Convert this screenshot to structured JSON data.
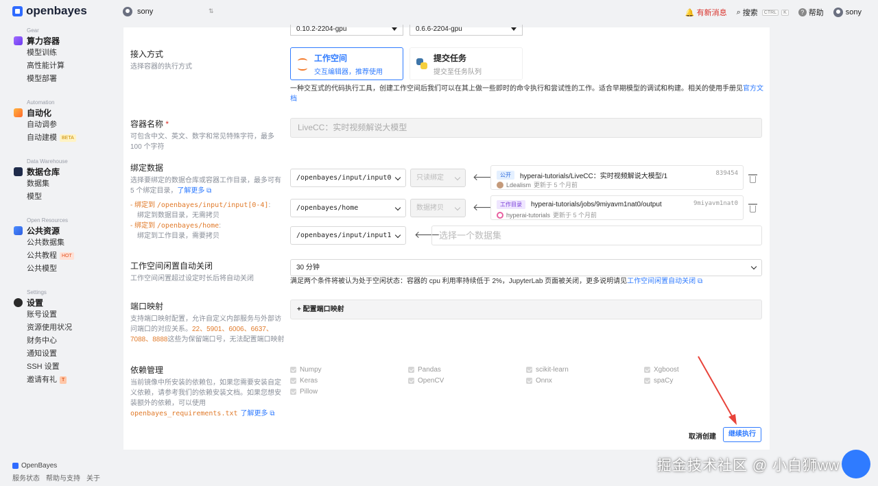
{
  "topbar": {
    "logo": "openbayes",
    "user": "sony",
    "notifications": "有新消息",
    "search": "搜索",
    "search_kbd1": "CTRL",
    "search_kbd2": "K",
    "help": "帮助",
    "account": "sony"
  },
  "sidebar": {
    "sections": [
      {
        "category": "Gear",
        "title": "算力容器",
        "items": [
          "模型训练",
          "高性能计算",
          "模型部署"
        ]
      },
      {
        "category": "Automation",
        "title": "自动化",
        "items": [
          "自动调参",
          "自动建模"
        ],
        "badge": "BETA"
      },
      {
        "category": "Data Warehouse",
        "title": "数据仓库",
        "items": [
          "数据集",
          "模型"
        ]
      },
      {
        "category": "Open Resources",
        "title": "公共资源",
        "items": [
          "公共数据集",
          "公共教程",
          "公共模型"
        ],
        "badge": "HOT"
      },
      {
        "category": "Settings",
        "title": "设置",
        "items": [
          "账号设置",
          "资源使用状况",
          "财务中心",
          "通知设置",
          "SSH 设置",
          "邀请有礼"
        ],
        "badge": "T"
      }
    ],
    "footer": {
      "brand": "OpenBayes",
      "links": [
        "服务状态",
        "帮助与支持",
        "关于"
      ]
    }
  },
  "form": {
    "version_a": "0.10.2-2204-gpu",
    "version_b": "0.6.6-2204-gpu",
    "access": {
      "label": "接入方式",
      "desc": "选择容器的执行方式",
      "workspace_title": "工作空间",
      "workspace_sub": "交互编辑器，推荐使用",
      "task_title": "提交任务",
      "task_sub": "提交至任务队列",
      "info": "一种交互式的代码执行工具，创建工作空间后我们可以在其上做一些即时的命令执行和尝试性的工作。适合早期模型的调试和构建。相关的使用手册见",
      "info_link": "官方文档"
    },
    "name": {
      "label": "容器名称",
      "required": "*",
      "desc": "可包含中文、英文、数字和常见特殊字符，最多 100 个字符",
      "value": "LiveCC：实时视频解说大模型"
    },
    "bind": {
      "label": "绑定数据",
      "desc": "选择要绑定的数据仓库或容器工作目录，最多可有 5 个绑定目录，",
      "learn_more": "了解更多",
      "rule1_prefix": "- 绑定到",
      "rule1_path": "/openbayes/input/input[0-4]",
      "rule1_suffix": ":",
      "rule1_desc": "绑定到数据目录，无需拷贝",
      "rule2_prefix": "- 绑定到",
      "rule2_path": "/openbayes/home",
      "rule2_suffix": ":",
      "rule2_desc": "绑定到工作目录，需要拷贝",
      "rows": [
        {
          "path": "/openbayes/input/input0",
          "mode": "只读绑定",
          "tag": "公开",
          "name": "hyperai-tutorials/LiveCC：实时视频解说大模型/1",
          "hash": "839454",
          "user": "Ldealism",
          "updated": "更新于 5 个月前"
        },
        {
          "path": "/openbayes/home",
          "mode": "数据拷贝",
          "tag": "工作目录",
          "name": "hyperai-tutorials/jobs/9miyavm1nat0/output",
          "hash": "9miyavm1nat0",
          "user": "hyperai-tutorials",
          "updated": "更新于 5 个月前"
        }
      ],
      "empty_path": "/openbayes/input/input1",
      "empty_placeholder": "选择一个数据集"
    },
    "idle": {
      "label": "工作空间闲置自动关闭",
      "desc": "工作空间闲置超过设定时长后将自动关闭",
      "value": "30 分钟",
      "info": "满足两个条件将被认为处于空闲状态：容器的 cpu 利用率持续低于 2%，JupyterLab 页面被关闭，更多说明请见",
      "info_link": "工作空间闲置自动关闭"
    },
    "port": {
      "label": "端口映射",
      "desc": "支持端口映射配置，允许自定义内部服务与外部访问端口的对应关系。",
      "reserved": "22、5901、6006、6637、7088、8888",
      "desc2": "这些为保留端口号，无法配置端口映射",
      "button": "+ 配置端口映射"
    },
    "deps": {
      "label": "依赖管理",
      "desc": "当前镜像中所安装的依赖包，如果您需要安装自定义依赖，请参考我们的依赖安装文档。如果您想安装额外的依赖，可以使用",
      "file": "openbayes_requirements.txt",
      "learn_more": "了解更多",
      "packages": [
        "Numpy",
        "Pandas",
        "scikit-learn",
        "Xgboost",
        "Keras",
        "OpenCV",
        "Onnx",
        "spaCy",
        "Pillow"
      ]
    },
    "actions": {
      "cancel": "取消创建",
      "submit": "继续执行"
    }
  },
  "watermark": "掘金技术社区 @ 小白狮ww",
  "colors": {
    "accent": "#2f7bff",
    "warning": "#d9312a",
    "orange": "#e07a2a"
  }
}
